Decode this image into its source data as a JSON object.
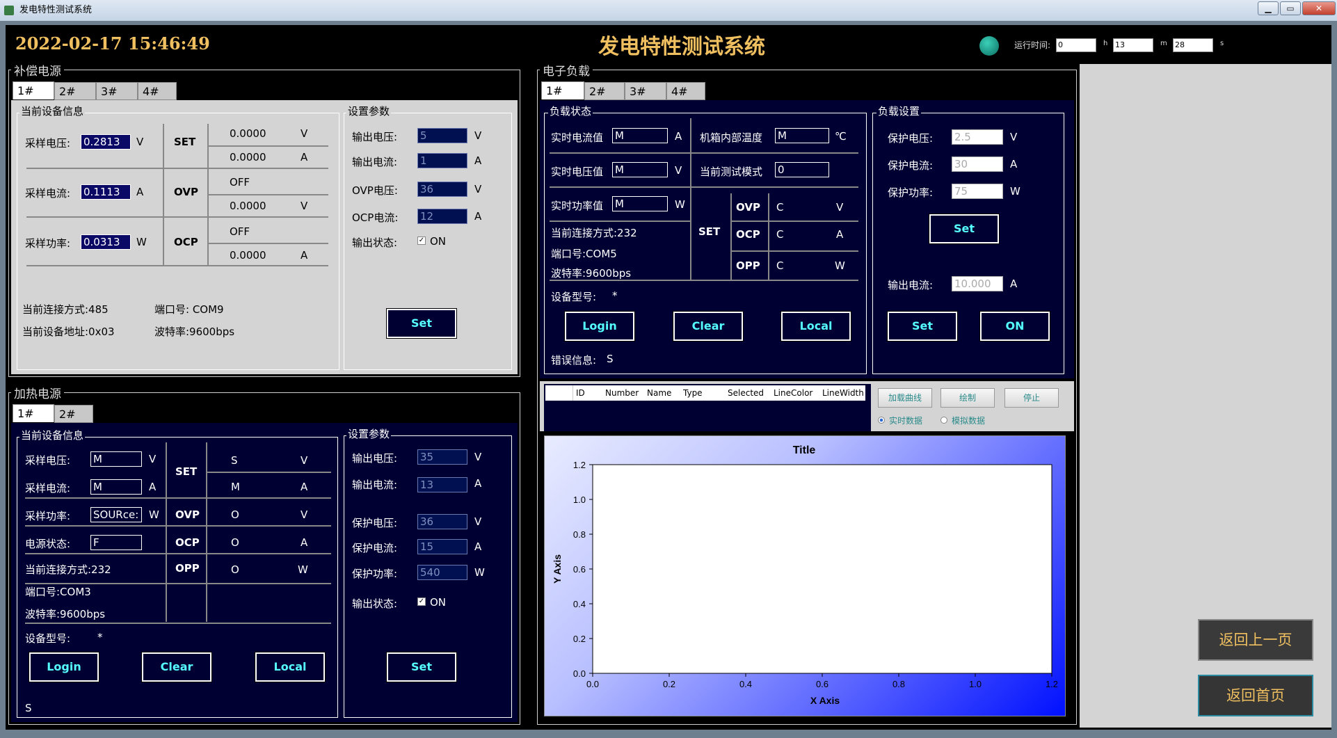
{
  "window": {
    "title": "发电特性测试系统",
    "min": "▁",
    "max": "▭",
    "close": "✕"
  },
  "header": {
    "datetime": "2022-02-17 15:46:49",
    "title": "发电特性测试系统",
    "runtime_label": "运行时间:",
    "hours": "0",
    "h_unit": "h",
    "minutes": "13",
    "m_unit": "m",
    "seconds": "28",
    "s_unit": "s"
  },
  "comp_power": {
    "title": "补偿电源",
    "tabs": [
      "1#",
      "2#",
      "3#",
      "4#"
    ],
    "info_title": "当前设备信息",
    "v_label": "采样电压:",
    "v_value": "0.2813",
    "v_unit": "V",
    "i_label": "采样电流:",
    "i_value": "0.1113",
    "i_unit": "A",
    "p_label": "采样功率:",
    "p_value": "0.0313",
    "p_unit": "W",
    "set_label": "SET",
    "ovp_label": "OVP",
    "ocp_label": "OCP",
    "set_v": "0.0000",
    "set_v_unit": "V",
    "set_a": "0.0000",
    "set_a_unit": "A",
    "ovp_state": "OFF",
    "ovp_v": "0.0000",
    "ovp_unit": "V",
    "ocp_state": "OFF",
    "ocp_a": "0.0000",
    "ocp_unit": "A",
    "conn": "当前连接方式:485",
    "port": "端口号: COM9",
    "addr": "当前设备地址:0x03",
    "baud": "波特率:9600bps",
    "param_title": "设置参数",
    "out_v_label": "输出电压:",
    "out_v": "5",
    "out_v_unit": "V",
    "out_i_label": "输出电流:",
    "out_i": "1",
    "out_i_unit": "A",
    "ovp_v_label": "OVP电压:",
    "ovp_set": "36",
    "ovp_set_unit": "V",
    "ocp_i_label": "OCP电流:",
    "ocp_set": "12",
    "ocp_set_unit": "A",
    "out_state_label": "输出状态:",
    "out_state": "ON",
    "set_btn": "Set"
  },
  "heat_power": {
    "title": "加热电源",
    "tabs": [
      "1#",
      "2#"
    ],
    "info_title": "当前设备信息",
    "v_label": "采样电压:",
    "v_value": "M",
    "v_unit": "V",
    "i_label": "采样电流:",
    "i_value": "M",
    "i_unit": "A",
    "p_label": "采样功率:",
    "p_value": "SOURce:",
    "p_unit": "W",
    "state_label": "电源状态:",
    "state_value": "F",
    "set_label": "SET",
    "ovp_label": "OVP",
    "ocp_label": "OCP",
    "opp_label": "OPP",
    "set_v": "S",
    "set_v_unit": "V",
    "set_a": "M",
    "set_a_unit": "A",
    "ovp": "O",
    "ovp_unit": "V",
    "ocp": "O",
    "ocp_unit": "A",
    "opp": "O",
    "opp_unit": "W",
    "conn": "当前连接方式:232",
    "port": "端口号:COM3",
    "baud": "波特率:9600bps",
    "model_label": "设备型号:",
    "model": "*",
    "login_btn": "Login",
    "clear_btn": "Clear",
    "local_btn": "Local",
    "error": "S",
    "param_title": "设置参数",
    "out_v_label": "输出电压:",
    "out_v": "35",
    "out_v_unit": "V",
    "out_i_label": "输出电流:",
    "out_i": "13",
    "out_i_unit": "A",
    "pv_label": "保护电压:",
    "pv": "36",
    "pv_unit": "V",
    "pi_label": "保护电流:",
    "pi": "15",
    "pi_unit": "A",
    "pp_label": "保护功率:",
    "pp": "540",
    "pp_unit": "W",
    "out_state_label": "输出状态:",
    "out_state": "ON",
    "set_btn": "Set"
  },
  "eload": {
    "title": "电子负载",
    "tabs": [
      "1#",
      "2#",
      "3#",
      "4#"
    ],
    "status_title": "负载状态",
    "cur_label": "实时电流值",
    "cur": "M",
    "cur_unit": "A",
    "vol_label": "实时电压值",
    "vol": "M",
    "vol_unit": "V",
    "pow_label": "实时功率值",
    "pow": "M",
    "pow_unit": "W",
    "temp_label": "机箱内部温度",
    "temp": "M",
    "temp_unit": "℃",
    "mode_label": "当前测试模式",
    "mode": "0",
    "set_label": "SET",
    "ovp_label": "OVP",
    "ovp": "C",
    "ovp_unit": "V",
    "ocp_label": "OCP",
    "ocp": "C",
    "ocp_unit": "A",
    "opp_label": "OPP",
    "opp": "C",
    "opp_unit": "W",
    "conn": "当前连接方式:232",
    "port": "端口号:COM5",
    "baud": "波特率:9600bps",
    "model_label": "设备型号:",
    "model": "*",
    "login_btn": "Login",
    "clear_btn": "Clear",
    "local_btn": "Local",
    "error_label": "错误信息:",
    "error": "S",
    "setting_title": "负载设置",
    "pv_label": "保护电压:",
    "pv": "2.5",
    "pv_unit": "V",
    "pi_label": "保护电流:",
    "pi": "30",
    "pi_unit": "A",
    "pp_label": "保护功率:",
    "pp": "75",
    "pp_unit": "W",
    "set_btn": "Set",
    "out_i_label": "输出电流:",
    "out_i": "10.000",
    "out_i_unit": "A",
    "set_btn2": "Set",
    "on_btn": "ON"
  },
  "curves": {
    "columns": [
      "ID",
      "Number",
      "Name",
      "Type",
      "Selected",
      "LineColor",
      "LineWidth"
    ],
    "load_btn": "加载曲线",
    "draw_btn": "绘制",
    "stop_btn": "停止",
    "radio_real": "实时数据",
    "radio_sim": "模拟数据"
  },
  "chart_data": {
    "type": "line",
    "title": "Title",
    "xlabel": "X Axis",
    "ylabel": "Y Axis",
    "xlim": [
      0,
      1.2
    ],
    "ylim": [
      0,
      1.2
    ],
    "xticks": [
      "0.0",
      "0.2",
      "0.4",
      "0.6",
      "0.8",
      "1.0",
      "1.2"
    ],
    "yticks": [
      "0.0",
      "0.2",
      "0.4",
      "0.6",
      "0.8",
      "1.0",
      "1.2"
    ],
    "series": []
  },
  "nav": {
    "back": "返回上一页",
    "home": "返回首页"
  }
}
